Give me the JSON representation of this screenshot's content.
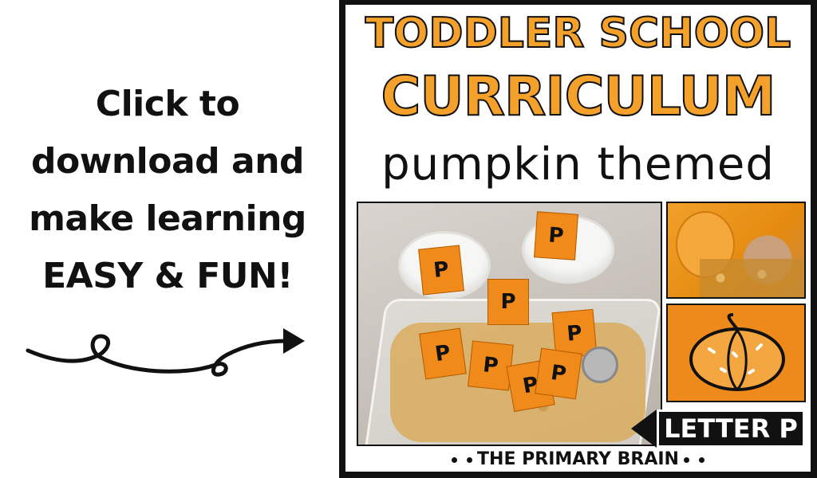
{
  "promo": {
    "lines": [
      "Click to",
      "download and",
      "make learning",
      "EASY & FUN!"
    ]
  },
  "card": {
    "title_line1": "TODDLER SCHOOL",
    "title_line2": "CURRICULUM",
    "subtitle": "pumpkin themed",
    "badge": "LETTER P",
    "brand": "THE PRIMARY BRAIN",
    "card_letter": "P"
  },
  "colors": {
    "title_orange": "#f3a12b",
    "pumpkin_orange": "#f08a1a",
    "ink": "#111111"
  },
  "icons": [
    "curly-arrow-icon",
    "pumpkin-icon"
  ]
}
